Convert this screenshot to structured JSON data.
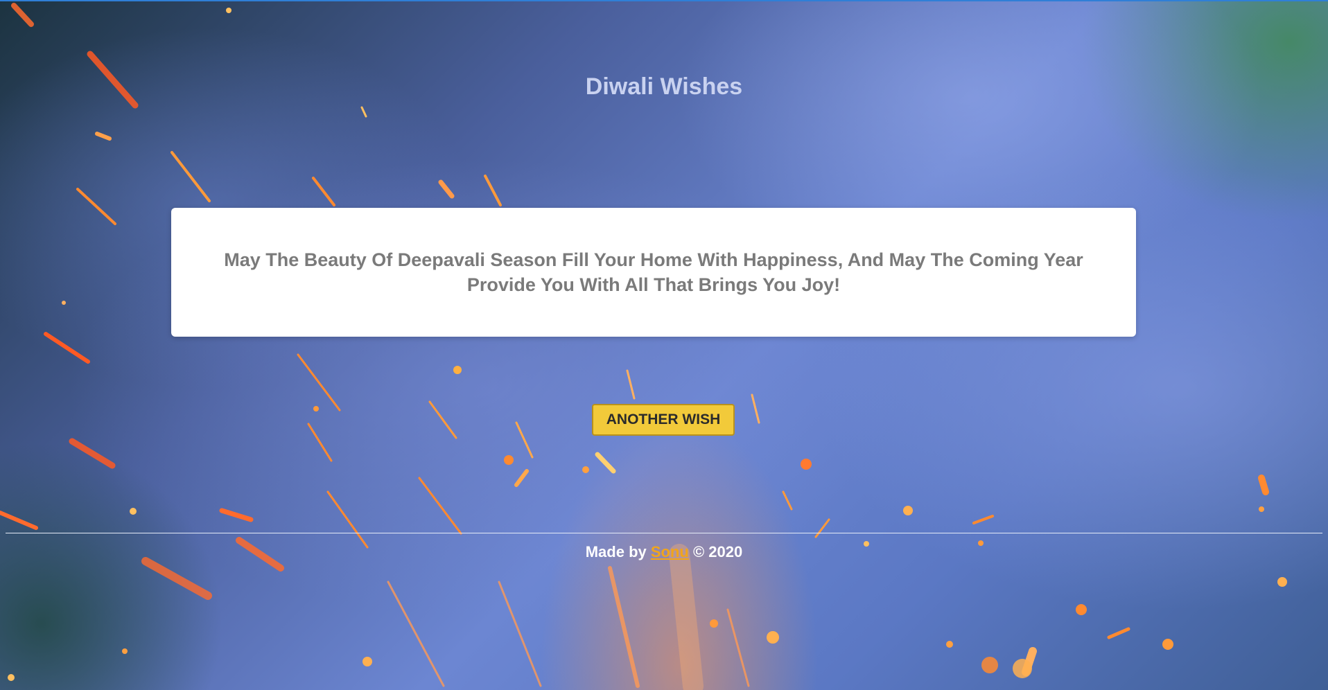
{
  "page": {
    "title": "Diwali Wishes"
  },
  "wish": {
    "text": "May The Beauty Of Deepavali Season Fill Your Home With Happiness, And May The Coming Year Provide You With All That Brings You Joy!"
  },
  "button": {
    "label": "ANOTHER WISH"
  },
  "footer": {
    "prefix": "Made by ",
    "author": "Sonu",
    "suffix": " © 2020"
  },
  "colors": {
    "accent": "#f2ca3a",
    "author_link": "#f2a51a",
    "title": "#c9d2f0",
    "wish_text": "#7a7a7a"
  }
}
